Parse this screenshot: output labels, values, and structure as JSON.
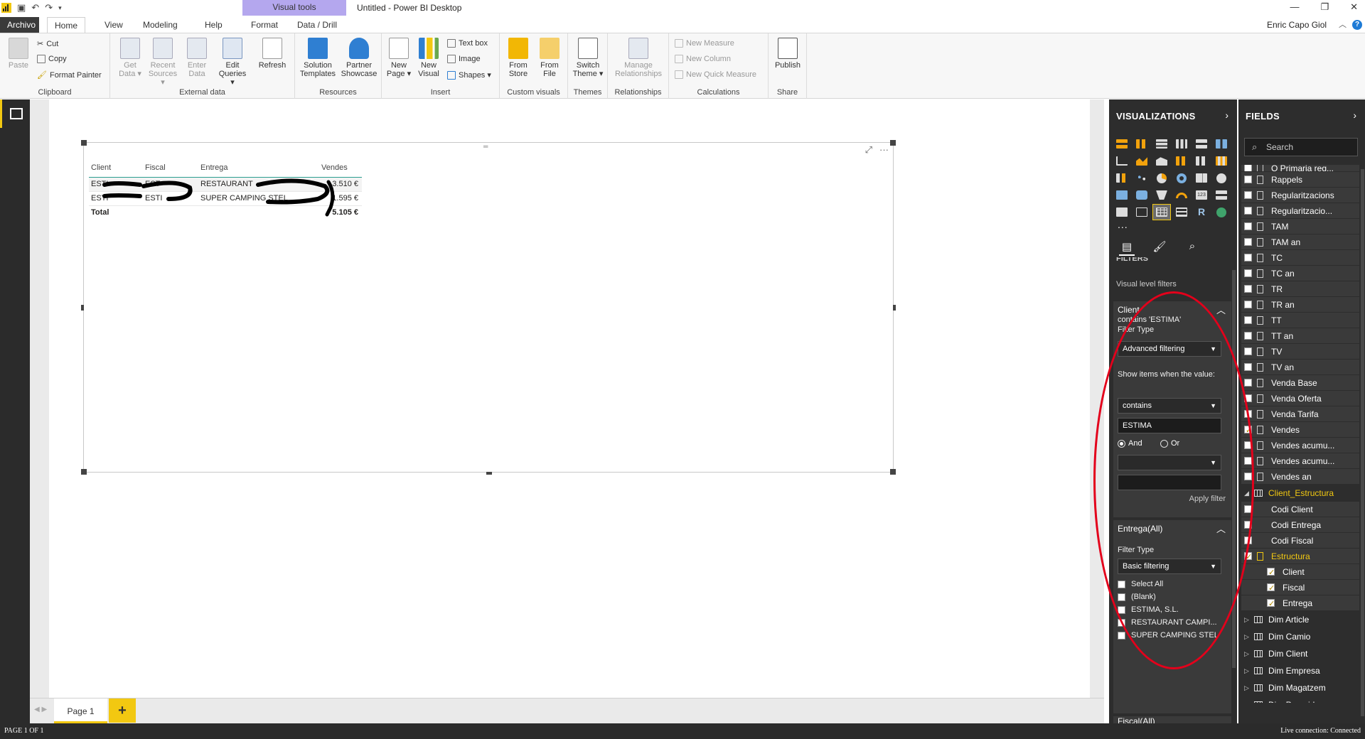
{
  "window": {
    "title": "Untitled - Power BI Desktop",
    "context_tab_group": "Visual tools",
    "user": "Enric Capo Giol",
    "help_label": "?"
  },
  "tabs": [
    "Archivo",
    "Home",
    "View",
    "Modeling",
    "Help",
    "Format",
    "Data / Drill"
  ],
  "ribbon": {
    "clipboard": {
      "label": "Clipboard",
      "paste": "Paste",
      "cut": "Cut",
      "copy": "Copy",
      "format_painter": "Format Painter"
    },
    "external": {
      "label": "External data",
      "get_data": [
        "Get",
        "Data ▾"
      ],
      "recent": [
        "Recent",
        "Sources ▾"
      ],
      "enter": [
        "Enter",
        "Data"
      ],
      "edit": [
        "Edit",
        "Queries ▾"
      ],
      "refresh": "Refresh"
    },
    "resources": {
      "label": "Resources",
      "solution": [
        "Solution",
        "Templates"
      ],
      "partner": [
        "Partner",
        "Showcase"
      ]
    },
    "insert": {
      "label": "Insert",
      "new_page": [
        "New",
        "Page ▾"
      ],
      "new_visual": [
        "New",
        "Visual"
      ],
      "text_box": "Text box",
      "image": "Image",
      "shapes": "Shapes ▾"
    },
    "custom": {
      "label": "Custom visuals",
      "store": [
        "From",
        "Store"
      ],
      "file": [
        "From",
        "File"
      ]
    },
    "themes": {
      "label": "Themes",
      "switch": [
        "Switch",
        "Theme ▾"
      ]
    },
    "relationships": {
      "label": "Relationships",
      "manage": [
        "Manage",
        "Relationships"
      ]
    },
    "calculations": {
      "label": "Calculations",
      "new_measure": "New Measure",
      "new_column": "New Column",
      "new_quick": "New Quick Measure"
    },
    "share": {
      "label": "Share",
      "publish": "Publish"
    }
  },
  "table_visual": {
    "headers": [
      "Client",
      "Fiscal",
      "Entrega",
      "Vendes"
    ],
    "rows": [
      [
        "ESTI",
        "EST",
        "RESTAURANT",
        "3.510 €"
      ],
      [
        "ESTI",
        "ESTI",
        "SUPER CAMPING STEL",
        "1.595 €"
      ]
    ],
    "total_label": "Total",
    "total_value": "5.105 €"
  },
  "page_tabs": {
    "page": "Page 1",
    "add": "+"
  },
  "status": {
    "left": "PAGE 1 OF 1",
    "right": "Live connection: Connected"
  },
  "visualizations": {
    "title": "VISUALIZATIONS",
    "more": "...",
    "filters_heading": "FILTERS",
    "visual_level_filters": "Visual level filters",
    "client_filter": {
      "title": "Client",
      "summary": "contains 'ESTIMA'",
      "filter_type_label": "Filter Type",
      "filter_type": "Advanced filtering",
      "show_items_label": "Show items when the value:",
      "operator": "contains",
      "value": "ESTIMA",
      "and_label": "And",
      "or_label": "Or",
      "second_operator": "",
      "second_value": "",
      "apply": "Apply filter"
    },
    "entrega_filter": {
      "title": "Entrega(All)",
      "filter_type_label": "Filter Type",
      "filter_type": "Basic filtering",
      "items": [
        "Select All",
        "(Blank)",
        "ESTIMA, S.L.",
        "RESTAURANT CAMPI...",
        "SUPER CAMPING STEL"
      ]
    },
    "fiscal_filter": {
      "title": "Fiscal(All)"
    }
  },
  "fields": {
    "title": "FIELDS",
    "search_placeholder": "Search",
    "measures": [
      {
        "name": "Q Primaria reg...",
        "checked": false
      },
      {
        "name": "Rappels",
        "checked": false
      },
      {
        "name": "Regularitzacions",
        "checked": false
      },
      {
        "name": "Regularitzacio...",
        "checked": false
      },
      {
        "name": "TAM",
        "checked": false
      },
      {
        "name": "TAM an",
        "checked": false
      },
      {
        "name": "TC",
        "checked": false
      },
      {
        "name": "TC an",
        "checked": false
      },
      {
        "name": "TR",
        "checked": false
      },
      {
        "name": "TR an",
        "checked": false
      },
      {
        "name": "TT",
        "checked": false
      },
      {
        "name": "TT an",
        "checked": false
      },
      {
        "name": "TV",
        "checked": false
      },
      {
        "name": "TV an",
        "checked": false
      },
      {
        "name": "Venda Base",
        "checked": false
      },
      {
        "name": "Venda Oferta",
        "checked": false
      },
      {
        "name": "Venda Tarifa",
        "checked": false
      },
      {
        "name": "Vendes",
        "checked": true
      },
      {
        "name": "Vendes acumu...",
        "checked": false
      },
      {
        "name": "Vendes acumu...",
        "checked": false
      },
      {
        "name": "Vendes an",
        "checked": false
      }
    ],
    "client_estructura": {
      "name": "Client_Estructura",
      "cols": [
        "Codi Client",
        "Codi Entrega",
        "Codi Fiscal"
      ],
      "hierarchy": "Estructura",
      "levels": [
        "Client",
        "Fiscal",
        "Entrega"
      ]
    },
    "tables": [
      "Dim Article",
      "Dim Camio",
      "Dim Client",
      "Dim Empresa",
      "Dim Magatzem",
      "Dim Proveidor"
    ]
  },
  "colors": {
    "accent": "#f2c811",
    "pane_bg": "#2d2d2d",
    "annotation": "#e3001b",
    "context_tab": "#b4a7ee"
  }
}
